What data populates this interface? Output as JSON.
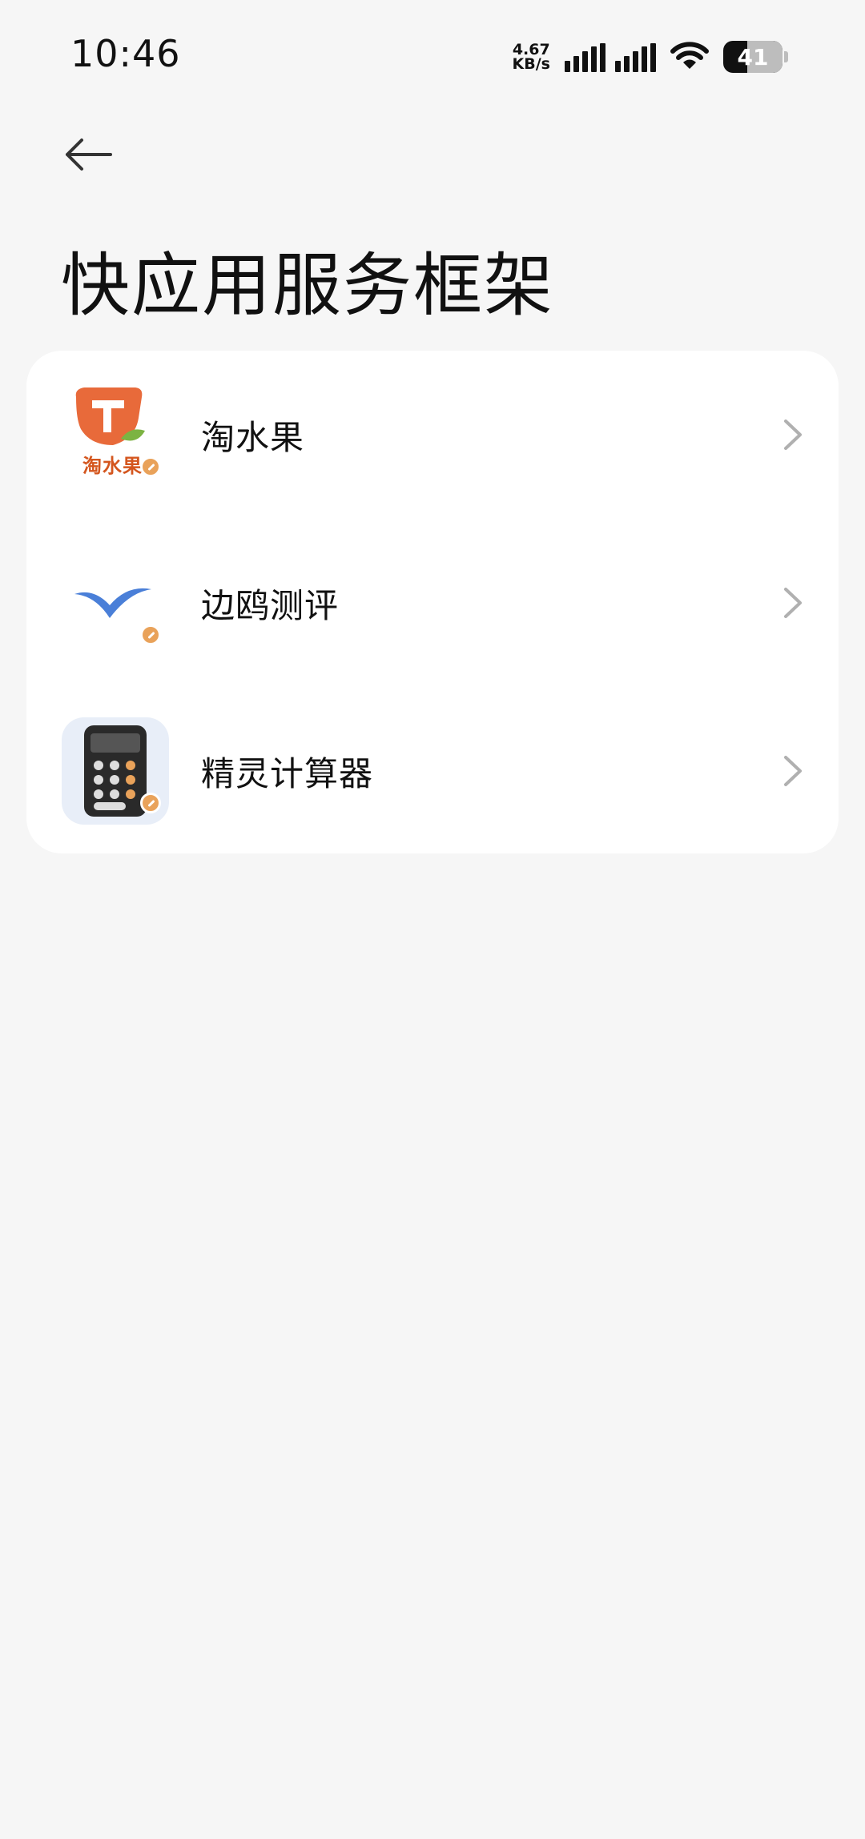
{
  "status_bar": {
    "time": "10:46",
    "net_speed_value": "4.67",
    "net_speed_unit": "KB/s",
    "battery_level": 41,
    "battery_text": "41"
  },
  "header": {
    "title": "快应用服务框架",
    "back_icon": "arrow-left-icon"
  },
  "apps": [
    {
      "label": "淘水果",
      "icon": "taoshuiguo-app-icon",
      "icon_text": "淘水果"
    },
    {
      "label": "边鸥测评",
      "icon": "bianou-app-icon"
    },
    {
      "label": "精灵计算器",
      "icon": "calculator-app-icon"
    }
  ],
  "colors": {
    "background": "#f6f6f6",
    "card": "#ffffff",
    "chevron": "#b0b0b0",
    "badge": "#e9a25a"
  }
}
